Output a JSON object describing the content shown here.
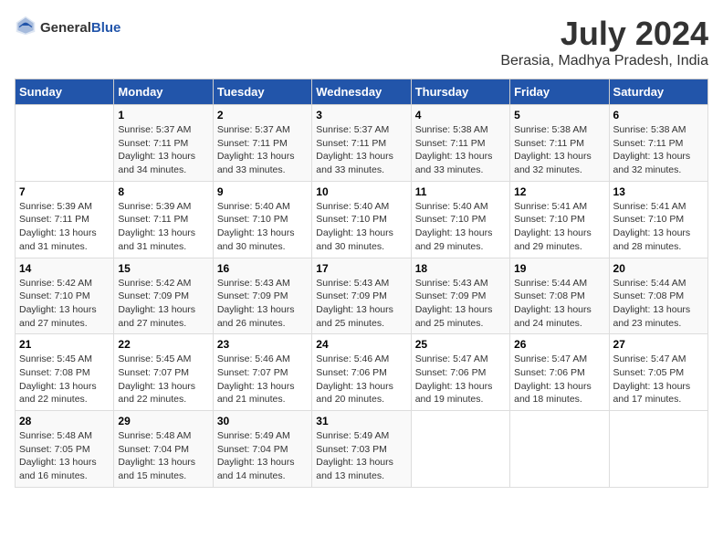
{
  "logo": {
    "general": "General",
    "blue": "Blue"
  },
  "title": "July 2024",
  "location": "Berasia, Madhya Pradesh, India",
  "days_of_week": [
    "Sunday",
    "Monday",
    "Tuesday",
    "Wednesday",
    "Thursday",
    "Friday",
    "Saturday"
  ],
  "weeks": [
    [
      {
        "day": "",
        "info": ""
      },
      {
        "day": "1",
        "info": "Sunrise: 5:37 AM\nSunset: 7:11 PM\nDaylight: 13 hours\nand 34 minutes."
      },
      {
        "day": "2",
        "info": "Sunrise: 5:37 AM\nSunset: 7:11 PM\nDaylight: 13 hours\nand 33 minutes."
      },
      {
        "day": "3",
        "info": "Sunrise: 5:37 AM\nSunset: 7:11 PM\nDaylight: 13 hours\nand 33 minutes."
      },
      {
        "day": "4",
        "info": "Sunrise: 5:38 AM\nSunset: 7:11 PM\nDaylight: 13 hours\nand 33 minutes."
      },
      {
        "day": "5",
        "info": "Sunrise: 5:38 AM\nSunset: 7:11 PM\nDaylight: 13 hours\nand 32 minutes."
      },
      {
        "day": "6",
        "info": "Sunrise: 5:38 AM\nSunset: 7:11 PM\nDaylight: 13 hours\nand 32 minutes."
      }
    ],
    [
      {
        "day": "7",
        "info": "Sunrise: 5:39 AM\nSunset: 7:11 PM\nDaylight: 13 hours\nand 31 minutes."
      },
      {
        "day": "8",
        "info": "Sunrise: 5:39 AM\nSunset: 7:11 PM\nDaylight: 13 hours\nand 31 minutes."
      },
      {
        "day": "9",
        "info": "Sunrise: 5:40 AM\nSunset: 7:10 PM\nDaylight: 13 hours\nand 30 minutes."
      },
      {
        "day": "10",
        "info": "Sunrise: 5:40 AM\nSunset: 7:10 PM\nDaylight: 13 hours\nand 30 minutes."
      },
      {
        "day": "11",
        "info": "Sunrise: 5:40 AM\nSunset: 7:10 PM\nDaylight: 13 hours\nand 29 minutes."
      },
      {
        "day": "12",
        "info": "Sunrise: 5:41 AM\nSunset: 7:10 PM\nDaylight: 13 hours\nand 29 minutes."
      },
      {
        "day": "13",
        "info": "Sunrise: 5:41 AM\nSunset: 7:10 PM\nDaylight: 13 hours\nand 28 minutes."
      }
    ],
    [
      {
        "day": "14",
        "info": "Sunrise: 5:42 AM\nSunset: 7:10 PM\nDaylight: 13 hours\nand 27 minutes."
      },
      {
        "day": "15",
        "info": "Sunrise: 5:42 AM\nSunset: 7:09 PM\nDaylight: 13 hours\nand 27 minutes."
      },
      {
        "day": "16",
        "info": "Sunrise: 5:43 AM\nSunset: 7:09 PM\nDaylight: 13 hours\nand 26 minutes."
      },
      {
        "day": "17",
        "info": "Sunrise: 5:43 AM\nSunset: 7:09 PM\nDaylight: 13 hours\nand 25 minutes."
      },
      {
        "day": "18",
        "info": "Sunrise: 5:43 AM\nSunset: 7:09 PM\nDaylight: 13 hours\nand 25 minutes."
      },
      {
        "day": "19",
        "info": "Sunrise: 5:44 AM\nSunset: 7:08 PM\nDaylight: 13 hours\nand 24 minutes."
      },
      {
        "day": "20",
        "info": "Sunrise: 5:44 AM\nSunset: 7:08 PM\nDaylight: 13 hours\nand 23 minutes."
      }
    ],
    [
      {
        "day": "21",
        "info": "Sunrise: 5:45 AM\nSunset: 7:08 PM\nDaylight: 13 hours\nand 22 minutes."
      },
      {
        "day": "22",
        "info": "Sunrise: 5:45 AM\nSunset: 7:07 PM\nDaylight: 13 hours\nand 22 minutes."
      },
      {
        "day": "23",
        "info": "Sunrise: 5:46 AM\nSunset: 7:07 PM\nDaylight: 13 hours\nand 21 minutes."
      },
      {
        "day": "24",
        "info": "Sunrise: 5:46 AM\nSunset: 7:06 PM\nDaylight: 13 hours\nand 20 minutes."
      },
      {
        "day": "25",
        "info": "Sunrise: 5:47 AM\nSunset: 7:06 PM\nDaylight: 13 hours\nand 19 minutes."
      },
      {
        "day": "26",
        "info": "Sunrise: 5:47 AM\nSunset: 7:06 PM\nDaylight: 13 hours\nand 18 minutes."
      },
      {
        "day": "27",
        "info": "Sunrise: 5:47 AM\nSunset: 7:05 PM\nDaylight: 13 hours\nand 17 minutes."
      }
    ],
    [
      {
        "day": "28",
        "info": "Sunrise: 5:48 AM\nSunset: 7:05 PM\nDaylight: 13 hours\nand 16 minutes."
      },
      {
        "day": "29",
        "info": "Sunrise: 5:48 AM\nSunset: 7:04 PM\nDaylight: 13 hours\nand 15 minutes."
      },
      {
        "day": "30",
        "info": "Sunrise: 5:49 AM\nSunset: 7:04 PM\nDaylight: 13 hours\nand 14 minutes."
      },
      {
        "day": "31",
        "info": "Sunrise: 5:49 AM\nSunset: 7:03 PM\nDaylight: 13 hours\nand 13 minutes."
      },
      {
        "day": "",
        "info": ""
      },
      {
        "day": "",
        "info": ""
      },
      {
        "day": "",
        "info": ""
      }
    ]
  ]
}
